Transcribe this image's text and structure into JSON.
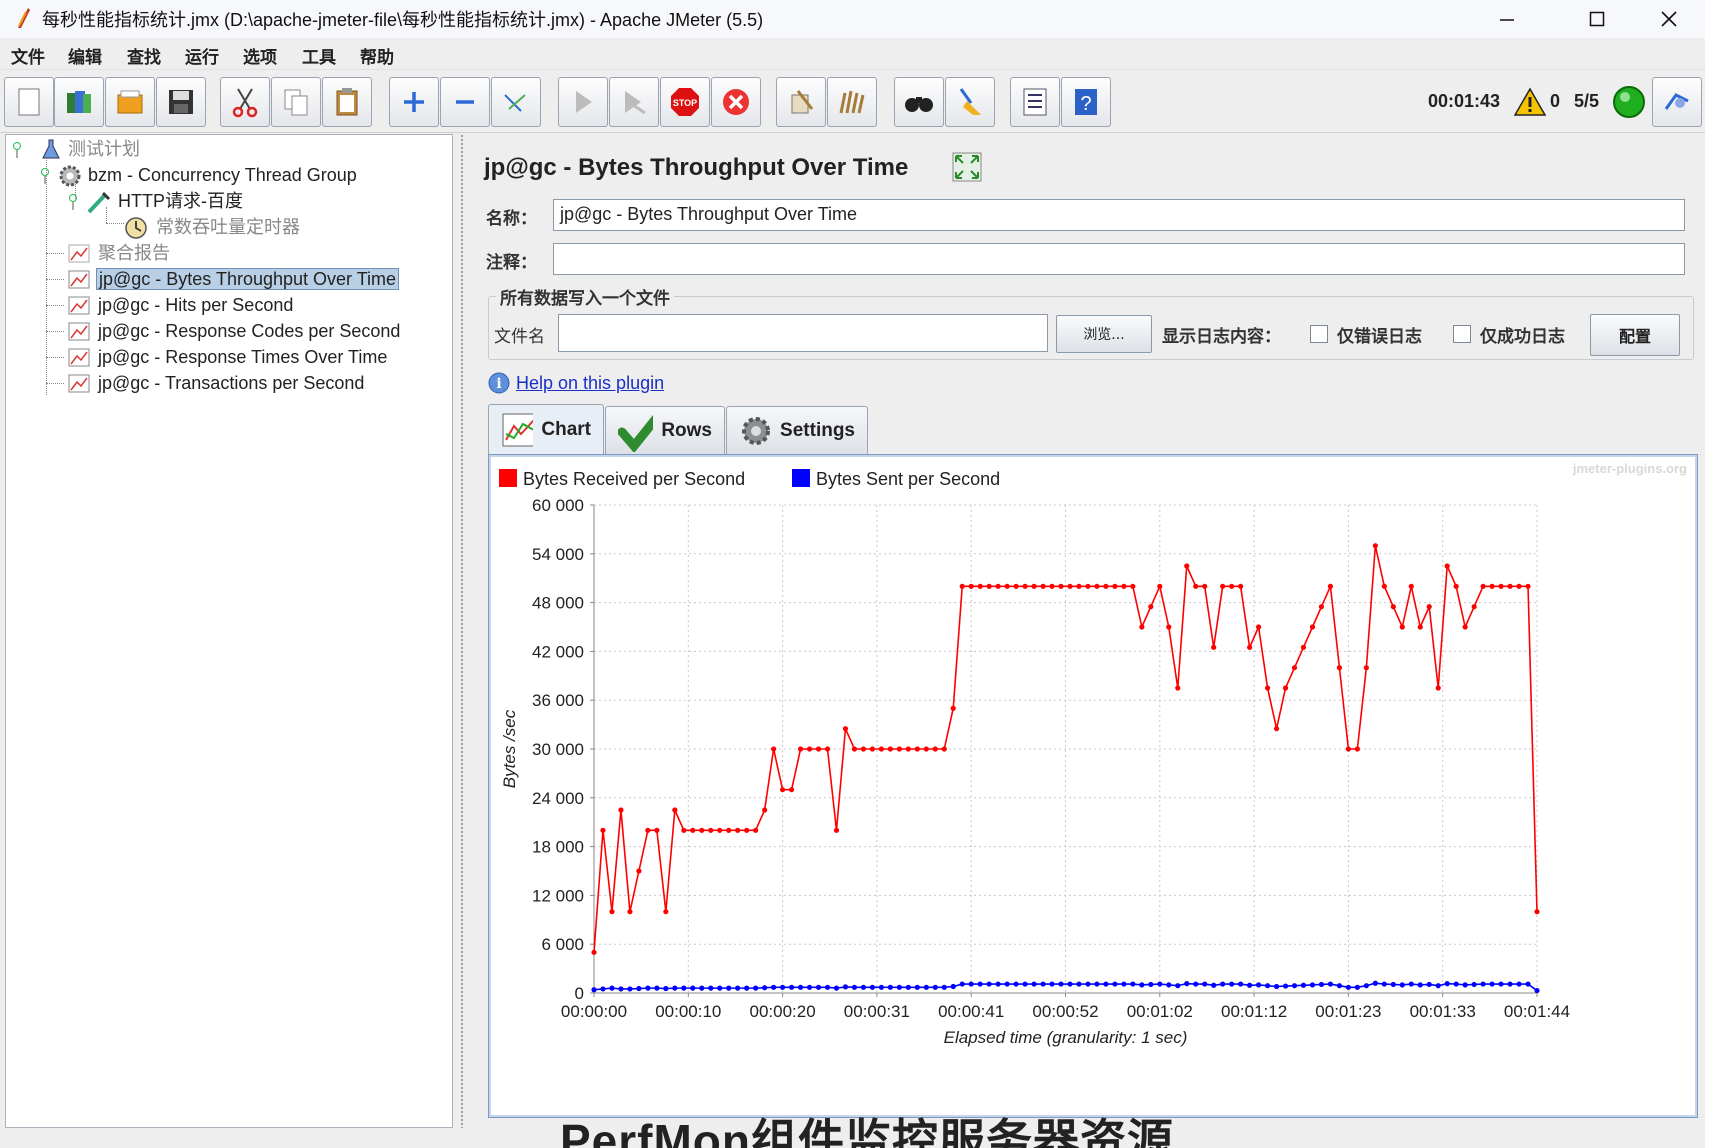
{
  "window": {
    "title": "每秒性能指标统计.jmx (D:\\apache-jmeter-file\\每秒性能指标统计.jmx) - Apache JMeter (5.5)"
  },
  "menu": [
    "文件",
    "编辑",
    "查找",
    "运行",
    "选项",
    "工具",
    "帮助"
  ],
  "toolbar": {
    "buttons": [
      "new-icon",
      "templates-icon",
      "open-icon",
      "save-icon",
      "cut-icon",
      "copy-icon",
      "paste-icon",
      "expand-all-icon",
      "collapse-all-icon",
      "toggle-icon",
      "start-icon",
      "start-no-pause-icon",
      "stop-icon",
      "shutdown-icon",
      "clear-icon",
      "clear-all-icon",
      "search-icon",
      "reset-search-icon",
      "function-helper-icon",
      "help-icon"
    ],
    "elapsed": "00:01:43",
    "warning_count": "0",
    "threads": "5/5",
    "status_color": "#1fae1f"
  },
  "tree": {
    "items": [
      {
        "label": "测试计划",
        "icon": "test-plan-icon",
        "disabled": true
      },
      {
        "label": "bzm - Concurrency Thread Group",
        "icon": "gear-icon",
        "disabled": false
      },
      {
        "label": "HTTP请求-百度",
        "icon": "pipette-icon",
        "disabled": false
      },
      {
        "label": "常数吞吐量定时器",
        "icon": "timer-icon",
        "disabled": true
      },
      {
        "label": "聚合报告",
        "icon": "graph-icon",
        "disabled": true
      },
      {
        "label": "jp@gc - Bytes Throughput Over Time",
        "icon": "graph-icon",
        "disabled": false,
        "selected": true
      },
      {
        "label": "jp@gc - Hits per Second",
        "icon": "graph-icon",
        "disabled": false
      },
      {
        "label": "jp@gc - Response Codes per Second",
        "icon": "graph-icon",
        "disabled": false
      },
      {
        "label": "jp@gc - Response Times Over Time",
        "icon": "graph-icon",
        "disabled": false
      },
      {
        "label": "jp@gc - Transactions per Second",
        "icon": "graph-icon",
        "disabled": false
      }
    ]
  },
  "panel": {
    "title": "jp@gc - Bytes Throughput Over Time",
    "name_label": "名称：",
    "name_value": "jp@gc - Bytes Throughput Over Time",
    "comment_label": "注释：",
    "comment_value": "",
    "fileset_legend": "所有数据写入一个文件",
    "filename_label": "文件名",
    "filename_value": "",
    "browse_button": "浏览...",
    "log_label": "显示日志内容：",
    "errors_only": "仅错误日志",
    "success_only": "仅成功日志",
    "config_button": "配置",
    "help_link": "Help on this plugin",
    "tabs": [
      "Chart",
      "Rows",
      "Settings"
    ]
  },
  "chart_data": {
    "type": "line",
    "watermark": "jmeter-plugins.org",
    "xlabel": "Elapsed time (granularity: 1 sec)",
    "ylabel": "Bytes /sec",
    "ylim": [
      0,
      60000
    ],
    "yticks": [
      "0",
      "6 000",
      "12 000",
      "18 000",
      "24 000",
      "30 000",
      "36 000",
      "42 000",
      "48 000",
      "54 000",
      "60 000"
    ],
    "xlim_seconds": [
      0,
      104
    ],
    "xticks": [
      "00:00:00",
      "00:00:10",
      "00:00:20",
      "00:00:31",
      "00:00:41",
      "00:00:52",
      "00:01:02",
      "00:01:12",
      "00:01:23",
      "00:01:33",
      "00:01:44"
    ],
    "grid": true,
    "legend_position": "top-left",
    "series": [
      {
        "name": "Bytes Received per Second",
        "color": "#ff0000",
        "values": [
          5000,
          20000,
          10000,
          22500,
          10000,
          15000,
          20000,
          20000,
          10000,
          22500,
          20000,
          20000,
          20000,
          20000,
          20000,
          20000,
          20000,
          20000,
          20000,
          22500,
          30000,
          25000,
          25000,
          30000,
          30000,
          30000,
          30000,
          20000,
          32500,
          30000,
          30000,
          30000,
          30000,
          30000,
          30000,
          30000,
          30000,
          30000,
          30000,
          30000,
          35000,
          50000,
          50000,
          50000,
          50000,
          50000,
          50000,
          50000,
          50000,
          50000,
          50000,
          50000,
          50000,
          50000,
          50000,
          50000,
          50000,
          50000,
          50000,
          50000,
          50000,
          45000,
          47500,
          50000,
          45000,
          37500,
          52500,
          50000,
          50000,
          42500,
          50000,
          50000,
          50000,
          42500,
          45000,
          37500,
          32500,
          37500,
          40000,
          42500,
          45000,
          47500,
          50000,
          40000,
          30000,
          30000,
          40000,
          55000,
          50000,
          47500,
          45000,
          50000,
          45000,
          47500,
          37500,
          52500,
          50000,
          45000,
          47500,
          50000,
          50000,
          50000,
          50000,
          50000,
          50000,
          10000
        ]
      },
      {
        "name": "Bytes Sent per Second",
        "color": "#0000ff",
        "values": [
          400,
          500,
          600,
          500,
          500,
          550,
          600,
          600,
          550,
          600,
          600,
          600,
          600,
          600,
          600,
          600,
          600,
          600,
          600,
          650,
          700,
          700,
          700,
          700,
          700,
          700,
          700,
          600,
          750,
          700,
          700,
          700,
          700,
          700,
          700,
          700,
          700,
          700,
          700,
          700,
          800,
          1100,
          1100,
          1100,
          1100,
          1100,
          1100,
          1100,
          1100,
          1100,
          1100,
          1100,
          1100,
          1100,
          1100,
          1100,
          1100,
          1100,
          1100,
          1100,
          1100,
          1000,
          1050,
          1100,
          1000,
          900,
          1150,
          1100,
          1100,
          950,
          1100,
          1100,
          1100,
          950,
          1000,
          900,
          800,
          850,
          900,
          950,
          1000,
          1050,
          1100,
          900,
          700,
          700,
          900,
          1200,
          1100,
          1050,
          1000,
          1100,
          1000,
          1050,
          900,
          1150,
          1100,
          1000,
          1050,
          1100,
          1100,
          1100,
          1100,
          1100,
          1100,
          300
        ]
      }
    ]
  },
  "background_text": "PerfMon组件监控服务器资源"
}
